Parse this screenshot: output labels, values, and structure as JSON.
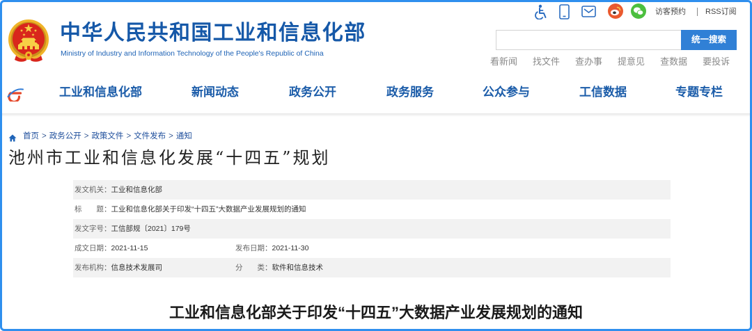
{
  "header": {
    "title": "中华人民共和国工业和信息化部",
    "subtitle": "Ministry of Industry and Information Technology of the People's Republic of China",
    "visitor_booking": "访客预约",
    "rss": "RSS订阅",
    "search": {
      "value": "",
      "button": "统一搜索"
    },
    "quick_links": [
      "看新闻",
      "找文件",
      "查办事",
      "提意见",
      "查数据",
      "要投诉"
    ],
    "icons": [
      "national-emblem",
      "accessibility-icon",
      "mobile-icon",
      "mail-icon",
      "weibo-icon",
      "wechat-icon",
      "e-gov-logo-icon",
      "home-icon"
    ]
  },
  "nav": {
    "items": [
      "工业和信息化部",
      "新闻动态",
      "政务公开",
      "政务服务",
      "公众参与",
      "工信数据",
      "专题专栏"
    ]
  },
  "breadcrumb": {
    "separator": ">",
    "items": [
      "首页",
      "政务公开",
      "政策文件",
      "文件发布",
      "通知"
    ]
  },
  "page_title": "池州市工业和信息化发展“十四五”规划",
  "document_info": {
    "issuer": {
      "label": "发文机关：",
      "value": "工业和信息化部"
    },
    "title": {
      "label": "标　　题：",
      "value": "工业和信息化部关于印发“十四五”大数据产业发展规划的通知"
    },
    "doc_number": {
      "label": "发文字号：",
      "value": "工信部规〔2021〕179号"
    },
    "written_date": {
      "label": "成文日期：",
      "value": "2021-11-15"
    },
    "publish_date": {
      "label": "发布日期：",
      "value": "2021-11-30"
    },
    "publisher": {
      "label": "发布机构：",
      "value": "信息技术发展司"
    },
    "category": {
      "label": "分　　类：",
      "value": "软件和信息技术"
    }
  },
  "article_title": "工业和信息化部关于印发“十四五”大数据产业发展规划的通知",
  "colors": {
    "primary": "#1558a8",
    "nav_text": "#1b5ca9",
    "search_button": "#3080d6",
    "frame": "#2f8fee",
    "row_alt": "#f2f2f2",
    "weibo": "#ea5a2f",
    "wechat": "#4cbf3f"
  }
}
